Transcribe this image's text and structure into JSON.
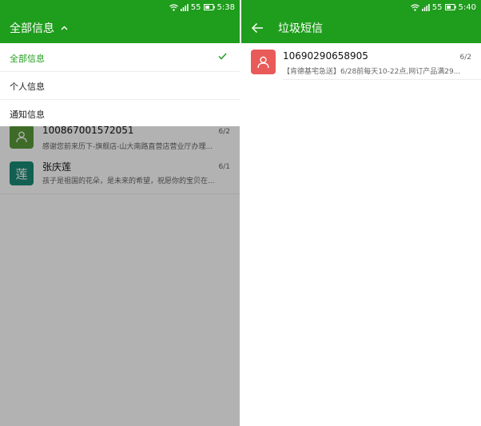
{
  "left": {
    "status": {
      "signal": "55",
      "time": "5:38"
    },
    "title": "全部信息",
    "dropdown": [
      {
        "label": "全部信息",
        "selected": true
      },
      {
        "label": "个人信息",
        "selected": false
      },
      {
        "label": "通知信息",
        "selected": false
      }
    ],
    "conversations": [
      {
        "name": "100867001572051",
        "date": "6/2",
        "preview": "感谢您前来历下-旗舰店-山大南路直营店营业厅办理..."
      },
      {
        "name": "张庆莲",
        "avatar_text": "莲",
        "date": "6/1",
        "preview": "孩子是祖国的花朵，是未来的希望，祝愿你的宝贝在..."
      }
    ]
  },
  "right": {
    "status": {
      "signal": "55",
      "time": "5:40"
    },
    "title": "垃圾短信",
    "messages": [
      {
        "sender": "10690290658905",
        "date": "6/2",
        "preview": "【肯德基宅急送】6/28前每天10-22点,网订产品满29..."
      }
    ]
  },
  "colors": {
    "accent": "#1f9d1d",
    "avatar_green": "#5a9a3a",
    "avatar_teal": "#1a8a74",
    "avatar_red": "#e85b58"
  }
}
